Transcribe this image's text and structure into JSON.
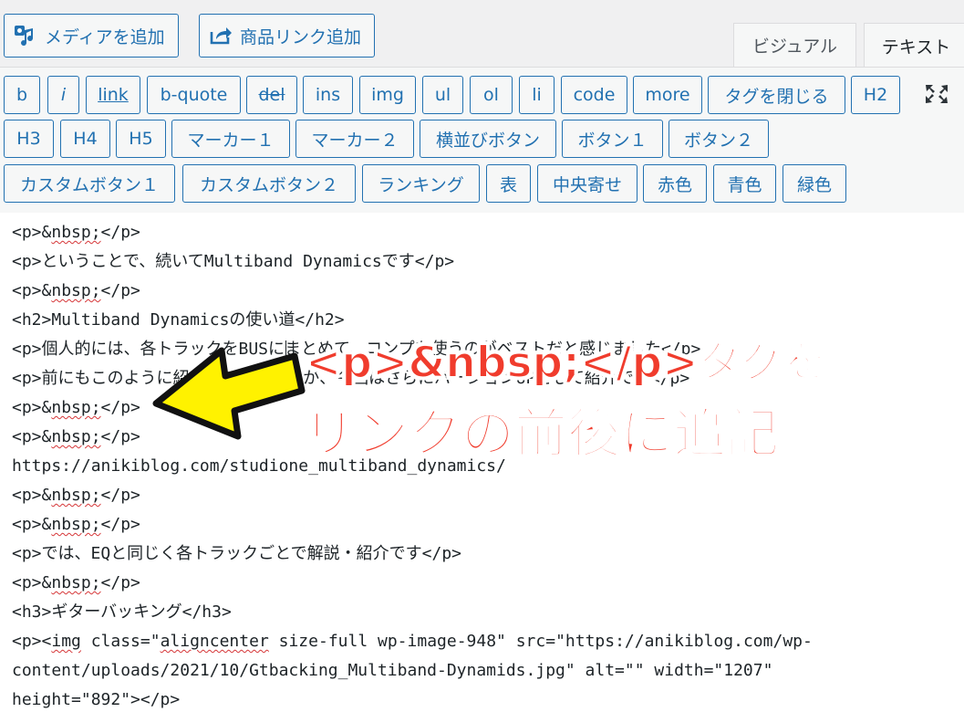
{
  "header": {
    "add_media_label": "メディアを追加",
    "add_product_link_label": "商品リンク追加",
    "tab_visual": "ビジュアル",
    "tab_text": "テキスト"
  },
  "toolbar": {
    "row1": [
      "b",
      "i",
      "link",
      "b-quote",
      "del",
      "ins",
      "img",
      "ul",
      "ol",
      "li",
      "code",
      "more",
      "タグを閉じる",
      "H2"
    ],
    "row2": [
      "H3",
      "H4",
      "H5",
      "マーカー１",
      "マーカー２",
      "横並びボタン",
      "ボタン１",
      "ボタン２"
    ],
    "row3": [
      "カスタムボタン１",
      "カスタムボタン２",
      "ランキング",
      "表",
      "中央寄せ",
      "赤色",
      "青色",
      "緑色"
    ]
  },
  "editor": {
    "lines": [
      "<p>&nbsp;</p>",
      "<p>ということで、続いてMultiband Dynamicsです</p>",
      "<p>&nbsp;</p>",
      "<h2>Multiband Dynamicsの使い道</h2>",
      "<p>個人的には、各トラックをBUSにまとめて、コンプを使うのがベストだと感じました</p>",
      "<p>前にもこのように紹介してきましたが、今回はさらにバージョンUPをして紹介です</p>",
      "<p>&nbsp;</p>",
      "<p>&nbsp;</p>",
      "https://anikiblog.com/studione_multiband_dynamics/",
      "<p>&nbsp;</p>",
      "<p>&nbsp;</p>",
      "<p>では、EQと同じく各トラックごとで解説・紹介です</p>",
      "<p>&nbsp;</p>",
      "<h3>ギターバッキング</h3>",
      "<p><img class=\"aligncenter size-full wp-image-948\" src=\"https://anikiblog.com/wp-",
      "content/uploads/2021/10/Gtbacking_Multiband-Dynamids.jpg\" alt=\"\" width=\"1207\"",
      "height=\"892\"></p>"
    ]
  },
  "annotation": {
    "line1": "<p>&nbsp;</p>タグを",
    "line2": "リンクの前後に追記",
    "text_color": "#f03c2d",
    "arrow_color": "#fff200"
  },
  "colors": {
    "accent": "#2271b1",
    "toolbar_bg": "#f6f7f7",
    "editor_bg": "#ffffff"
  }
}
